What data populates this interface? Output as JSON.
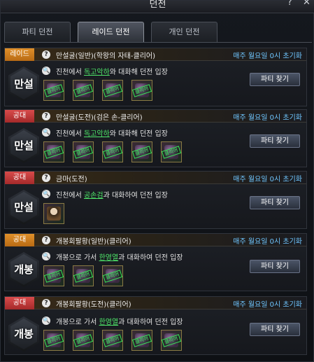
{
  "window": {
    "title": "던전",
    "help": "?",
    "close": "✕"
  },
  "tabs": [
    {
      "label": "파티 던전",
      "active": false
    },
    {
      "label": "레이드 던전",
      "active": true
    },
    {
      "label": "개인 던전",
      "active": false
    }
  ],
  "colors": {
    "tag_orange": "#e0902a",
    "tag_red": "#d84b4b",
    "reset_text": "#6fc6ff",
    "npc_text": "#4fe86a"
  },
  "common": {
    "party_button": "파티 찾기",
    "reset_text": "매주 월요일 0시 초기화",
    "clear_stamp": "클리어"
  },
  "dungeons": [
    {
      "tag": "레이드",
      "title": "만설굴(일반)(학왕의 자태-클리어)",
      "emblem": "만설",
      "desc_pre": "진천에서 ",
      "npc": "독고악하",
      "desc_post": "와 대화해 던전 입장",
      "reward_count": 4
    },
    {
      "tag": "공대",
      "title": "만설굴(도전)(검은 손-클리어)",
      "emblem": "만설",
      "desc_pre": "진천에서 ",
      "npc": "독고악하",
      "desc_post": "와 대화해 던전 입장",
      "reward_count": 5
    },
    {
      "tag": "공대",
      "title": "금마(도전)",
      "emblem": "만설",
      "desc_pre": "진천에서 ",
      "npc": "공손검",
      "desc_post": "과 대화하여 던전 입장",
      "reward_count": 1
    },
    {
      "tag": "공대",
      "title": "개봉회팔황(일반)(클리어)",
      "emblem": "개봉",
      "desc_pre": "개봉으로 가서 ",
      "npc": "한영열",
      "desc_post": "과 대화하여 던전 입장",
      "reward_count": 3
    },
    {
      "tag": "공대",
      "title": "개봉회팔황(도전)(클리어)",
      "emblem": "개봉",
      "desc_pre": "개봉으로 가서 ",
      "npc": "한영열",
      "desc_post": "과 대화하여 던전 입장",
      "reward_count": 5
    }
  ]
}
